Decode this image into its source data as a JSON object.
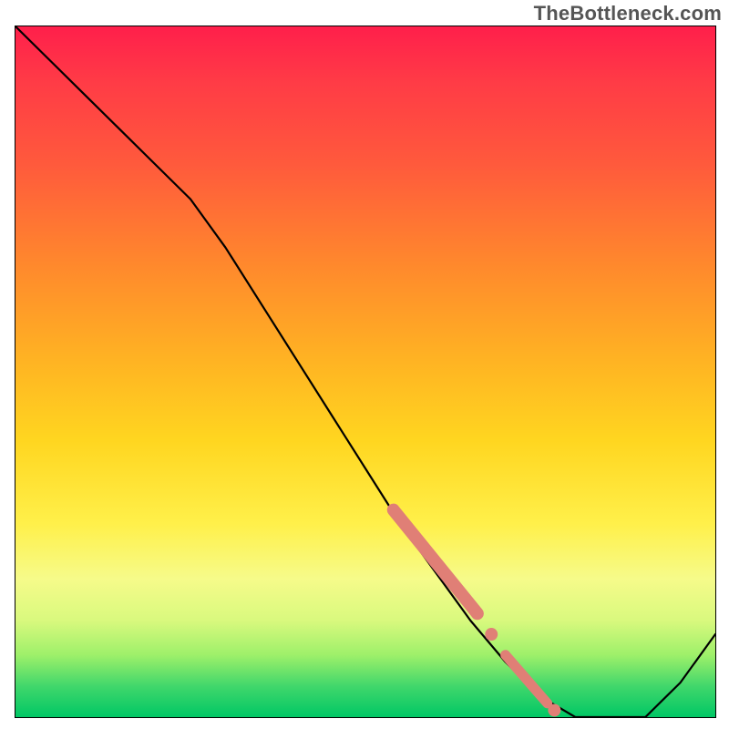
{
  "watermark": "TheBottleneck.com",
  "chart_data": {
    "type": "line",
    "title": "",
    "xlabel": "",
    "ylabel": "",
    "xlim": [
      0,
      100
    ],
    "ylim": [
      0,
      100
    ],
    "x": [
      0,
      5,
      10,
      15,
      20,
      25,
      30,
      35,
      40,
      45,
      50,
      55,
      60,
      65,
      70,
      75,
      80,
      85,
      90,
      95,
      100
    ],
    "values": [
      100,
      95,
      90,
      85,
      80,
      75,
      68,
      60,
      52,
      44,
      36,
      28,
      21,
      14,
      8,
      3,
      0,
      0,
      0,
      5,
      12
    ],
    "highlight_segments": [
      {
        "x": [
          54,
          66
        ],
        "values": [
          30,
          15
        ]
      },
      {
        "x": [
          70,
          76
        ],
        "values": [
          9,
          2
        ]
      }
    ],
    "highlight_points": [
      {
        "x": 68,
        "y": 12
      },
      {
        "x": 77,
        "y": 1
      }
    ],
    "background_gradient": {
      "direction": "vertical",
      "stops": [
        {
          "pos": 0,
          "color": "#ff1f4b"
        },
        {
          "pos": 50,
          "color": "#ffc820"
        },
        {
          "pos": 80,
          "color": "#fff04a"
        },
        {
          "pos": 100,
          "color": "#00c765"
        }
      ]
    }
  }
}
